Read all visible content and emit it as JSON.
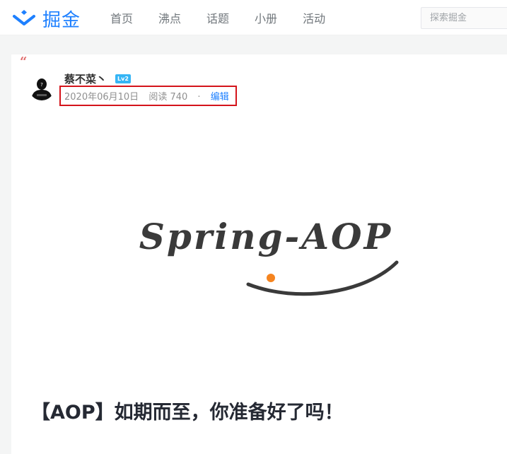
{
  "header": {
    "logo_text": "掘金",
    "nav": [
      "首页",
      "沸点",
      "话题",
      "小册",
      "活动"
    ],
    "search_placeholder": "探索掘金"
  },
  "article": {
    "quote_mark": "“",
    "author": {
      "name": "蔡不菜丶",
      "level": "Lv2"
    },
    "date": "2020年06月10日",
    "reads": "阅读 740",
    "separator": "·",
    "edit_label": "编辑",
    "cover_text": "Spring-AOP",
    "title": "【AOP】如期而至，你准备好了吗！"
  },
  "colors": {
    "brand": "#1e80ff",
    "highlight_box": "#d4141b",
    "level_badge": "#35b5f5",
    "cover_dot": "#f5841f"
  }
}
